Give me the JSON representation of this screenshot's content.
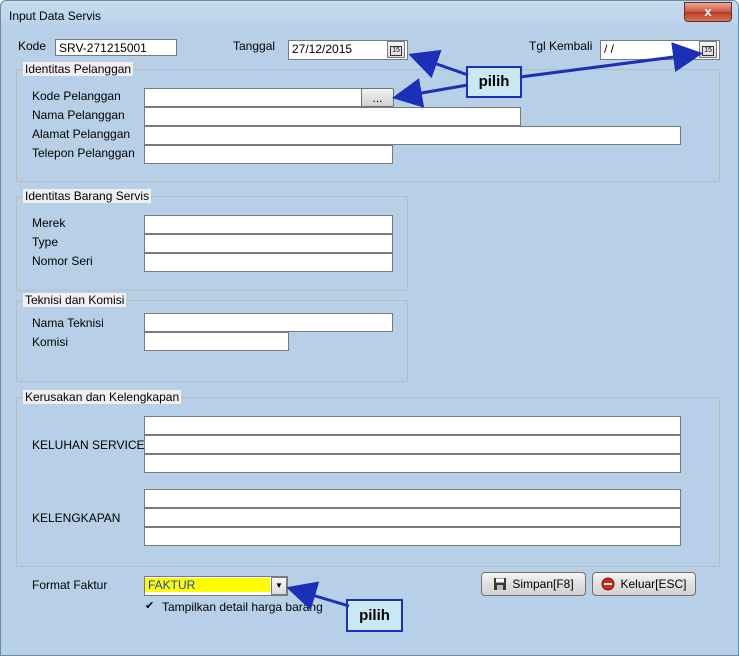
{
  "window": {
    "title": "Input Data Servis",
    "close_symbol": "x"
  },
  "header": {
    "kode_label": "Kode",
    "kode_value": "SRV-271215001",
    "tanggal_label": "Tanggal",
    "tanggal_value": "27/12/2015",
    "kembali_label": "Tgl Kembali",
    "kembali_value": "/  /"
  },
  "pelanggan": {
    "legend": "Identitas Pelanggan",
    "kode_label": "Kode Pelanggan",
    "kode_value": "",
    "browse_label": "...",
    "nama_label": "Nama Pelanggan",
    "nama_value": "",
    "alamat_label": "Alamat Pelanggan",
    "alamat_value": "",
    "telepon_label": "Telepon Pelanggan",
    "telepon_value": ""
  },
  "barang": {
    "legend": "Identitas Barang Servis",
    "merek_label": "Merek",
    "merek_value": "",
    "type_label": "Type",
    "type_value": "",
    "seri_label": "Nomor Seri",
    "seri_value": ""
  },
  "teknisi": {
    "legend": "Teknisi dan Komisi",
    "nama_label": "Nama Teknisi",
    "nama_value": "",
    "komisi_label": "Komisi",
    "komisi_value": ""
  },
  "kerusakan": {
    "legend": "Kerusakan dan Kelengkapan",
    "keluhan_label": "KELUHAN SERVICE",
    "kelengkapan_label": "KELENGKAPAN"
  },
  "footer": {
    "format_label": "Format Faktur",
    "format_value": "FAKTUR",
    "detail_label": "Tampilkan detail harga barang",
    "detail_checked": "✔",
    "simpan_label": "Simpan[F8]",
    "keluar_label": "Keluar[ESC]"
  },
  "callouts": {
    "pilih_top": "pilih",
    "pilih_bottom": "pilih"
  },
  "colors": {
    "format_highlight": "#ffff00",
    "callout_border": "#1b2fb8",
    "callout_fill": "#c9e8f4"
  }
}
